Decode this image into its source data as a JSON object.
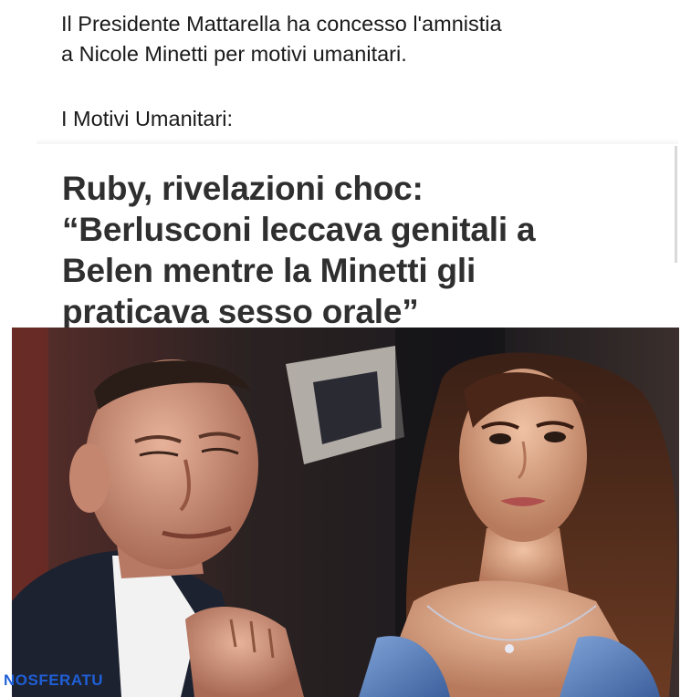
{
  "post": {
    "caption_line1": "Il Presidente Mattarella ha concesso l'amnistia",
    "caption_line2": "a Nicole Minetti per motivi umanitari.",
    "caption_line3": "I Motivi Umanitari:"
  },
  "article": {
    "headline_line1": "Ruby, rivelazioni choc:",
    "headline_line2": "“Berlusconi leccava genitali a",
    "headline_line3": "Belen mentre la Minetti gli",
    "headline_line4": "praticava sesso orale”"
  },
  "photo": {
    "subject": "news-photo-man-and-woman"
  },
  "watermark": {
    "text": "NOSFERATU"
  },
  "colors": {
    "caption_text": "#1a1a1a",
    "headline_text": "#2f2f2f",
    "watermark": "#1f5fd6"
  }
}
